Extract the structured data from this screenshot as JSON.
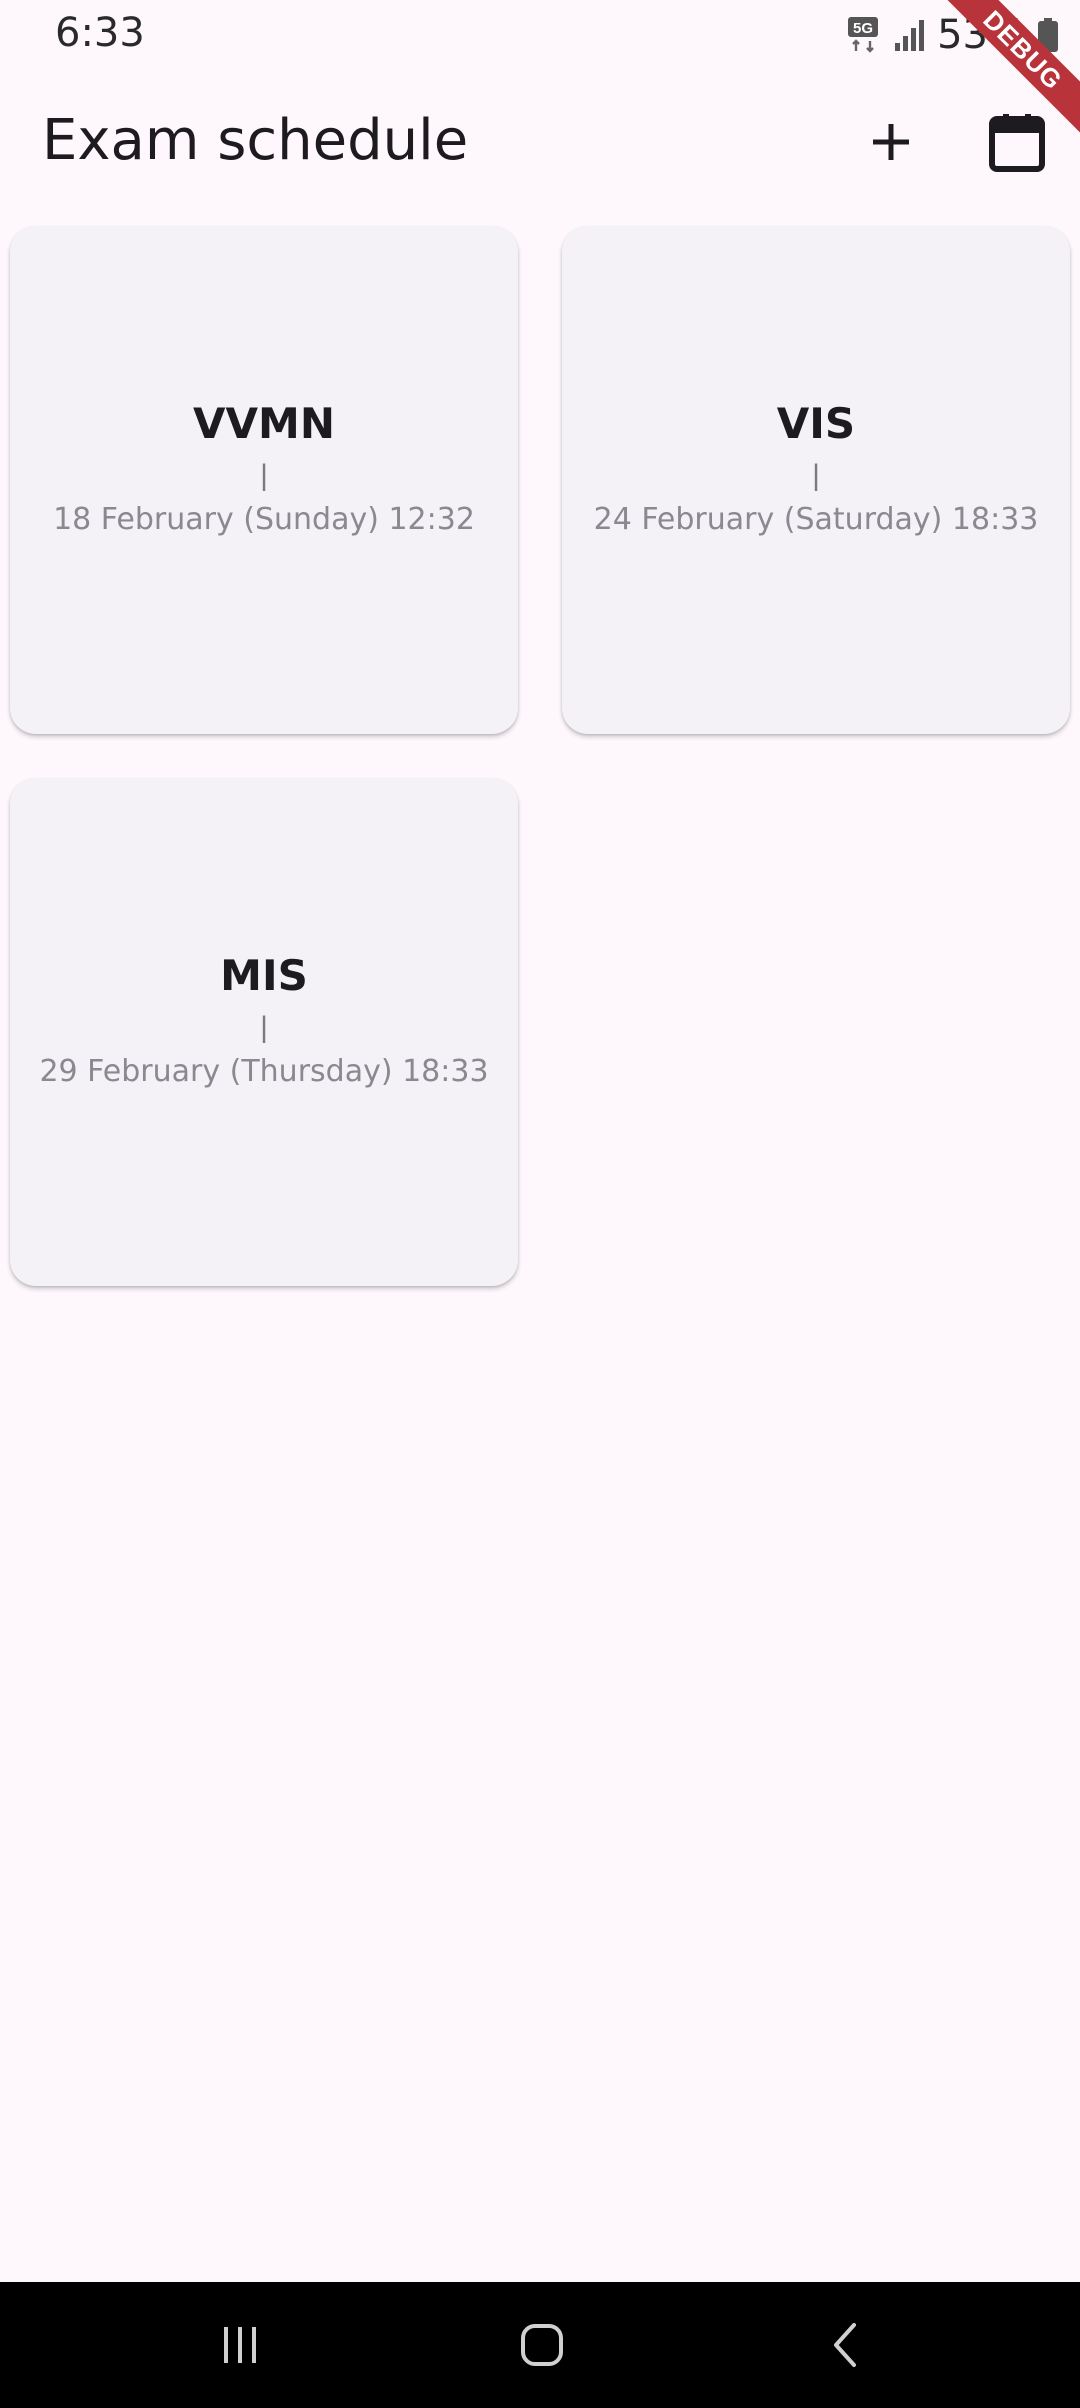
{
  "status_bar": {
    "time": "6:33",
    "network_label": "5G",
    "battery": "53%"
  },
  "debug_banner": "DEBUG",
  "app_bar": {
    "title": "Exam schedule",
    "add_icon": "plus-icon",
    "calendar_icon": "calendar-icon"
  },
  "exams": [
    {
      "subject": "VVMN",
      "separator": "|",
      "datetime": "18 February (Sunday) 12:32"
    },
    {
      "subject": "VIS",
      "separator": "|",
      "datetime": "24 February (Saturday) 18:33"
    },
    {
      "subject": "MIS",
      "separator": "|",
      "datetime": "29 February (Thursday) 18:33"
    }
  ],
  "nav_bar": {
    "recent_icon": "recent-apps-icon",
    "home_icon": "home-icon",
    "back_icon": "back-icon"
  },
  "colors": {
    "background": "#fef8fc",
    "card": "#f5f2f7",
    "debug": "#b8343a"
  }
}
